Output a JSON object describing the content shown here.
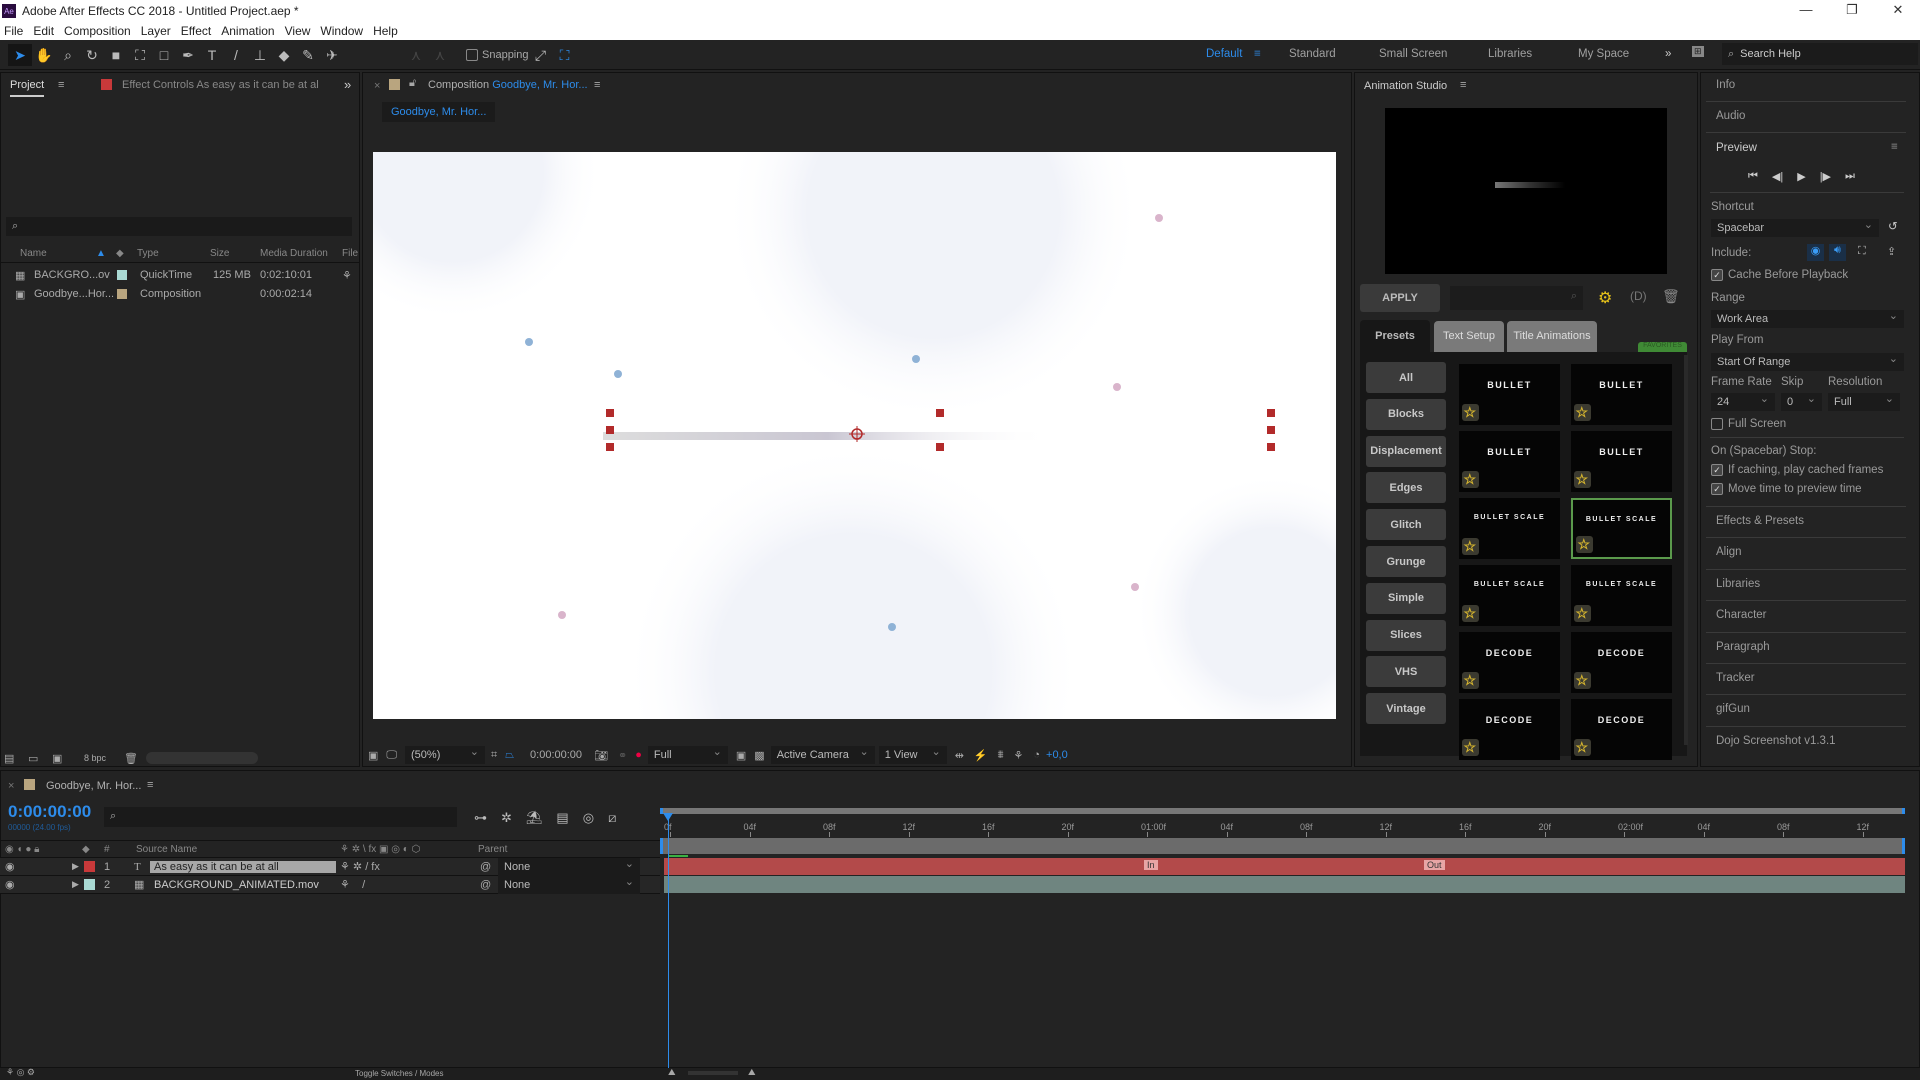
{
  "window": {
    "title": "Adobe After Effects CC 2018 - Untitled Project.aep *",
    "app_icon": "Ae",
    "controls": [
      "minimize-icon",
      "restore-icon",
      "close-icon"
    ]
  },
  "menu": [
    "File",
    "Edit",
    "Composition",
    "Layer",
    "Effect",
    "Animation",
    "View",
    "Window",
    "Help"
  ],
  "toolbar": {
    "snapping_label": "Snapping",
    "snapping": false,
    "workspaces": [
      {
        "label": "Default",
        "active": true
      },
      {
        "label": "Standard"
      },
      {
        "label": "Small Screen"
      },
      {
        "label": "Libraries"
      },
      {
        "label": "My Space"
      }
    ],
    "search_placeholder": "Search Help"
  },
  "project": {
    "tab_label": "Project",
    "effect_controls_label": "Effect Controls As easy as it can be at al",
    "columns": [
      "Name",
      "Type",
      "Size",
      "Media Duration",
      "File"
    ],
    "items": [
      {
        "name": "BACKGRO...ov",
        "type": "QuickTime",
        "size": "125 MB",
        "duration": "0:02:10:01",
        "label_color": "#a9d9d3"
      },
      {
        "name": "Goodbye...Hor...",
        "type": "Composition",
        "size": "",
        "duration": "0:00:02:14",
        "label_color": "#b9a57f"
      }
    ],
    "bpc": "8 bpc"
  },
  "composition": {
    "tab_prefix": "Composition",
    "tab_name": "Goodbye, Mr. Hor...",
    "subtab": "Goodbye, Mr. Hor...",
    "zoom": "(50%)",
    "timecode": "0:00:00:00",
    "resolution": "Full",
    "camera": "Active Camera",
    "views": "1 View",
    "exposure": "+0,0"
  },
  "animation_studio": {
    "title": "Animation Studio",
    "apply_label": "APPLY",
    "tabs": [
      "Presets",
      "Text Setup",
      "Title Animations"
    ],
    "favorites_label": "FAVORITES",
    "categories": [
      "All",
      "Blocks",
      "Displacement",
      "Edges",
      "Glitch",
      "Grunge",
      "Simple",
      "Slices",
      "VHS",
      "Vintage"
    ],
    "presets": [
      "BULLET",
      "BULLET",
      "BULLET",
      "BULLET",
      "BULLET SCALE",
      "BULLET SCALE",
      "BULLET SCALE",
      "BULLET SCALE",
      "DECODE",
      "DECODE",
      "DECODE",
      "DECODE"
    ],
    "selected_preset_index": 5
  },
  "right_panel": {
    "info": "Info",
    "audio": "Audio",
    "preview": "Preview",
    "shortcut_label": "Shortcut",
    "shortcut": "Spacebar",
    "include_label": "Include:",
    "cache_before_playback": "Cache Before Playback",
    "range_label": "Range",
    "range": "Work Area",
    "play_from_label": "Play From",
    "play_from": "Start Of Range",
    "frame_rate_label": "Frame Rate",
    "frame_rate": "24",
    "skip_label": "Skip",
    "skip": "0",
    "resolution_label": "Resolution",
    "resolution": "Full",
    "full_screen": "Full Screen",
    "stop_label": "On (Spacebar) Stop:",
    "stop_opt1": "If caching, play cached frames",
    "stop_opt2": "Move time to preview time",
    "panels": [
      "Effects & Presets",
      "Align",
      "Libraries",
      "Character",
      "Paragraph",
      "Tracker",
      "gifGun",
      "Dojo Screenshot v1.3.1"
    ]
  },
  "timeline": {
    "tab_label": "Goodbye, Mr. Hor...",
    "timecode": "0:00:00:00",
    "fps": "00000 (24.00 fps)",
    "columns": {
      "num": "#",
      "source": "Source Name",
      "parent": "Parent"
    },
    "layers": [
      {
        "num": "1",
        "name": "As easy as it can be at all",
        "type": "T",
        "color": "#c8393a",
        "parent": "None"
      },
      {
        "num": "2",
        "name": "BACKGROUND_ANIMATED.mov",
        "type": "footage",
        "color": "#a9d9d3",
        "parent": "None"
      }
    ],
    "ruler": [
      "0f",
      "04f",
      "08f",
      "12f",
      "16f",
      "20f",
      "01:00f",
      "04f",
      "08f",
      "12f",
      "16f",
      "20f",
      "02:00f",
      "04f",
      "08f",
      "12f"
    ],
    "markers": [
      "In",
      "Out"
    ],
    "toggle_label": "Toggle Switches / Modes"
  },
  "colors": {
    "accent": "#2d8ceb",
    "layer1_bar": "#b34a4a",
    "layer2_bar": "#6f8580",
    "selected": "#5b9a4c",
    "star": "#d6b52f"
  }
}
